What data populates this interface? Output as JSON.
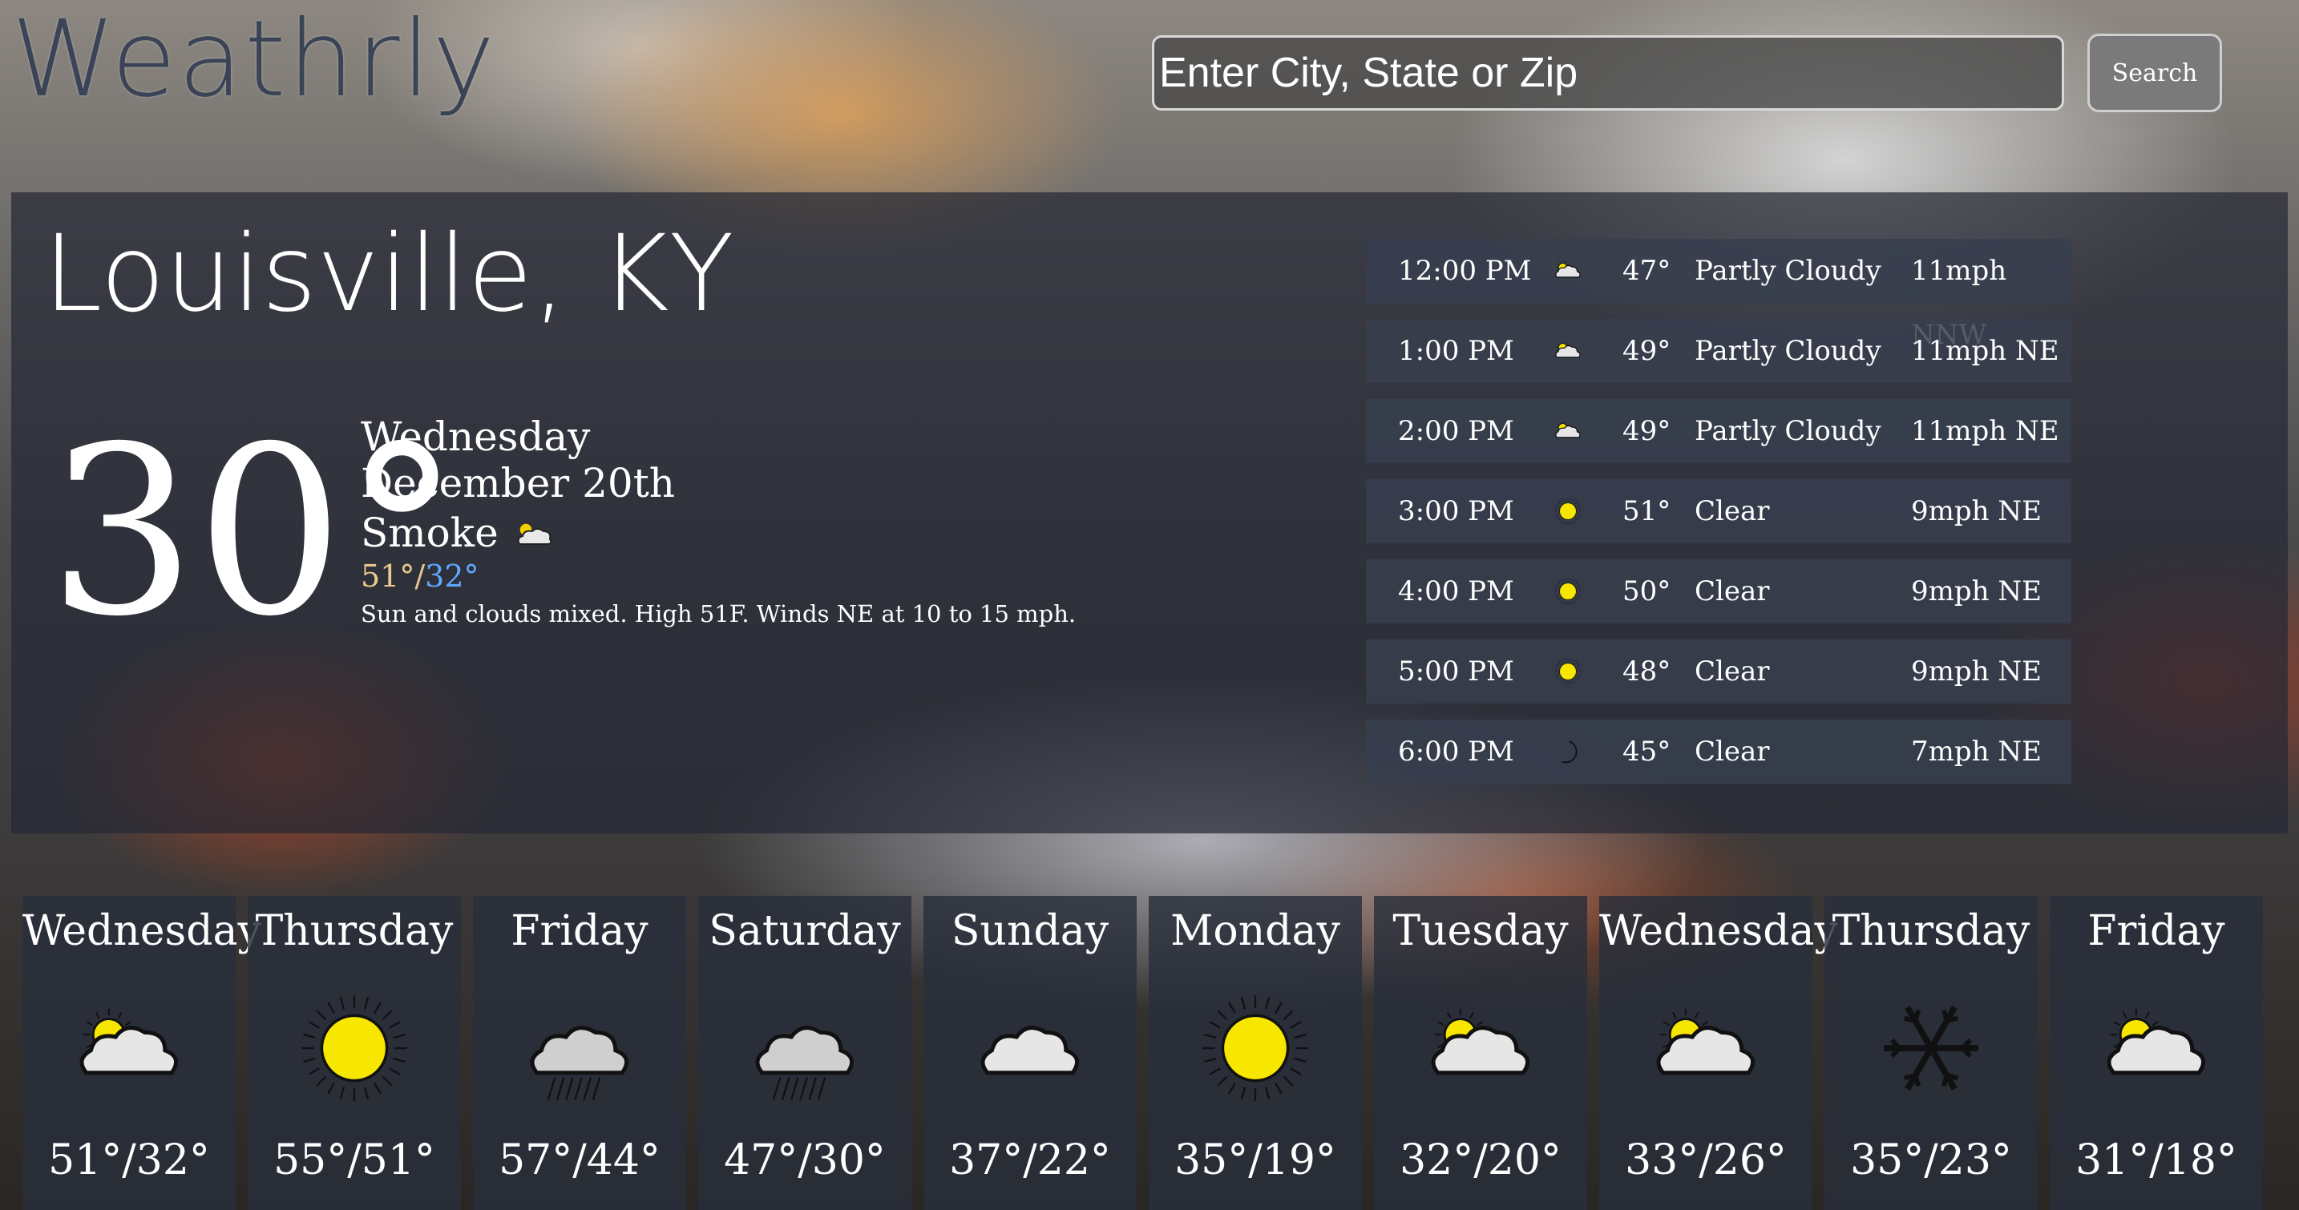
{
  "header": {
    "logo": "Weathrly",
    "search_placeholder": "Enter City, State or Zip",
    "search_button": "Search"
  },
  "current": {
    "city": "Louisville, KY",
    "temp": "30°",
    "day": "Wednesday",
    "date": "December 20th",
    "condition": "Smoke",
    "high": "51°",
    "separator": "/",
    "low": "32°",
    "summary": "Sun and clouds mixed. High 51F. Winds NE at 10 to 15 mph.",
    "condition_icon": "partly-cloudy-icon"
  },
  "hourly": [
    {
      "time": "12:00 PM",
      "icon": "partly-cloudy-icon",
      "temp": "47°",
      "condition": "Partly Cloudy",
      "wind": "11mph NNW"
    },
    {
      "time": "1:00 PM",
      "icon": "partly-cloudy-icon",
      "temp": "49°",
      "condition": "Partly Cloudy",
      "wind": "11mph NE"
    },
    {
      "time": "2:00 PM",
      "icon": "partly-cloudy-icon",
      "temp": "49°",
      "condition": "Partly Cloudy",
      "wind": "11mph NE"
    },
    {
      "time": "3:00 PM",
      "icon": "sun-icon",
      "temp": "51°",
      "condition": "Clear",
      "wind": "9mph NE"
    },
    {
      "time": "4:00 PM",
      "icon": "sun-icon",
      "temp": "50°",
      "condition": "Clear",
      "wind": "9mph NE"
    },
    {
      "time": "5:00 PM",
      "icon": "sun-icon",
      "temp": "48°",
      "condition": "Clear",
      "wind": "9mph NE"
    },
    {
      "time": "6:00 PM",
      "icon": "moon-icon",
      "temp": "45°",
      "condition": "Clear",
      "wind": "7mph NE"
    }
  ],
  "daily": [
    {
      "day": "Wednesday",
      "icon": "partly-cloudy-icon",
      "temps": "51°/32°"
    },
    {
      "day": "Thursday",
      "icon": "sun-icon",
      "temps": "55°/51°"
    },
    {
      "day": "Friday",
      "icon": "rain-icon",
      "temps": "57°/44°"
    },
    {
      "day": "Saturday",
      "icon": "rain-icon",
      "temps": "47°/30°"
    },
    {
      "day": "Sunday",
      "icon": "cloud-icon",
      "temps": "37°/22°"
    },
    {
      "day": "Monday",
      "icon": "sun-icon",
      "temps": "35°/19°"
    },
    {
      "day": "Tuesday",
      "icon": "partly-cloudy-icon",
      "temps": "32°/20°"
    },
    {
      "day": "Wednesday",
      "icon": "partly-cloudy-icon",
      "temps": "33°/26°"
    },
    {
      "day": "Thursday",
      "icon": "snow-icon",
      "temps": "35°/23°"
    },
    {
      "day": "Friday",
      "icon": "partly-cloudy-icon",
      "temps": "31°/18°"
    }
  ],
  "colors": {
    "high_temp": "#e9c98d",
    "low_temp": "#5ea8ff",
    "panel": "#262834",
    "logo": "#3a4456"
  }
}
